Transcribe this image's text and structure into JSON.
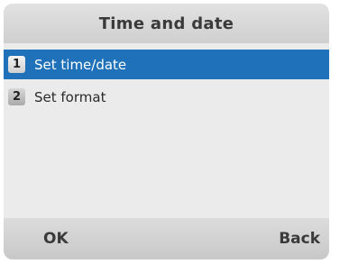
{
  "header": {
    "title": "Time and date"
  },
  "menu": {
    "items": [
      {
        "number": "1",
        "label": "Set time/date",
        "selected": true
      },
      {
        "number": "2",
        "label": "Set format",
        "selected": false
      }
    ]
  },
  "softkeys": {
    "left": "OK",
    "right": "Back"
  },
  "colors": {
    "selection": "#1f72b9",
    "background": "#ebebeb"
  }
}
